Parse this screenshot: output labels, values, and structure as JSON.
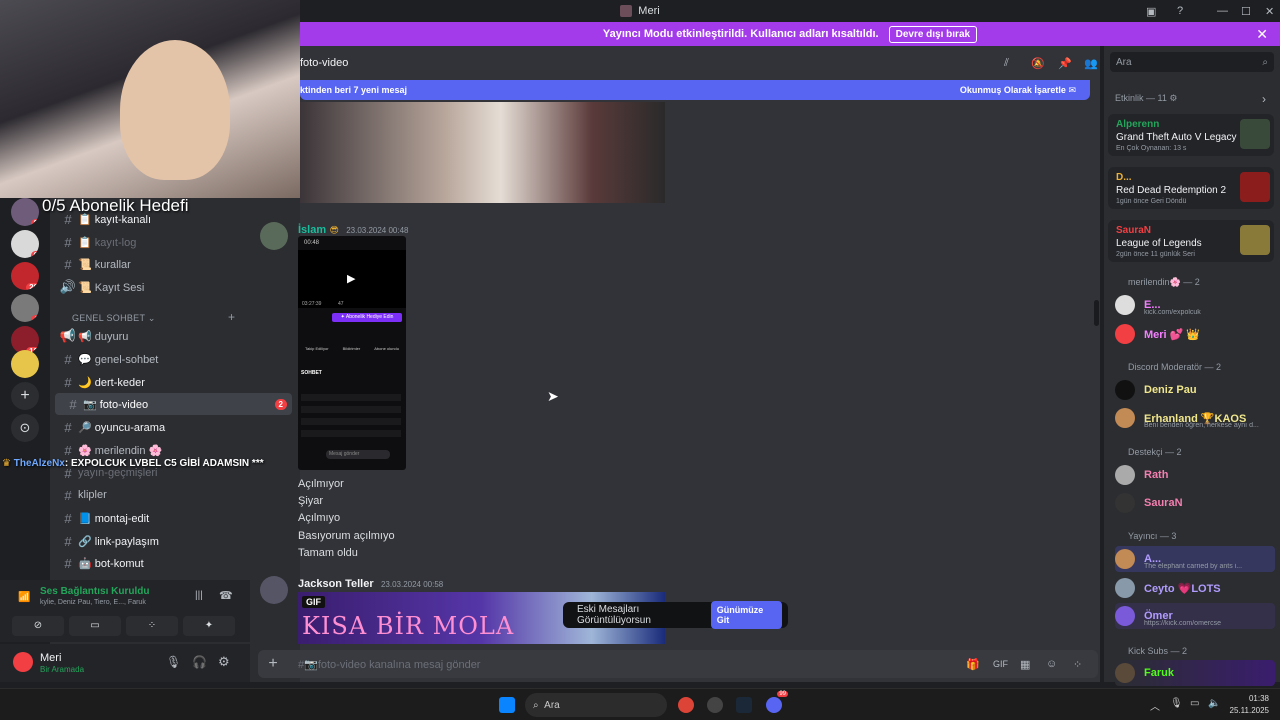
{
  "window": {
    "title": "Meri"
  },
  "banner": {
    "text": "Yayıncı Modu etkinleştirildi. Kullanıcı adları kısaltıldı.",
    "button": "Devre dışı bırak"
  },
  "overlay": {
    "goal": "0/5 Abonelik Hedefi",
    "chat_user": "TheAlzeNx",
    "chat_text": ": EXPOLCUK LVBEL C5 GİBİ ADAMSIN ***"
  },
  "rail": {
    "servers": [
      {
        "badge": "2"
      },
      {
        "badge": "6"
      },
      {
        "badge": "26"
      },
      {
        "badge": "4"
      },
      {
        "badge": "12"
      },
      {
        "badge": ""
      }
    ]
  },
  "channels": {
    "items": [
      {
        "label": "📋 kayıt-kanalı",
        "type": "text"
      },
      {
        "label": "📋 kayıt-log",
        "type": "text"
      },
      {
        "label": "📜 kurallar",
        "type": "text"
      },
      {
        "label": "📜 Kayıt Sesi",
        "type": "voice"
      }
    ],
    "category": "GENEL SOHBET",
    "general": [
      {
        "label": "📢 duyuru"
      },
      {
        "label": "💬 genel-sohbet"
      },
      {
        "label": "🌙 dert-keder"
      },
      {
        "label": "📷 foto-video",
        "count": "2"
      },
      {
        "label": "🔎 oyuncu-arama"
      },
      {
        "label": "🌸 merilendin 🌸"
      },
      {
        "label": "yayın-geçmişleri"
      },
      {
        "label": "klipler"
      },
      {
        "label": "📘 montaj-edit"
      },
      {
        "label": "🔗 link-paylaşım"
      },
      {
        "label": "🤖 bot-komut"
      }
    ]
  },
  "voice": {
    "status": "Ses Bağlantısı Kuruldu",
    "members": "kylie, Deniz Pau, Tiero, E..., Faruk"
  },
  "user": {
    "name": "Meri",
    "status": "Bir Aramada"
  },
  "chat": {
    "channel": "foto-video",
    "new_messages": "ktinden beri 7 yeni mesaj",
    "mark_read": "Okunmuş Olarak İşaretle",
    "msg1": {
      "author": "İslam",
      "time": "23.03.2024 00:48",
      "lines": [
        "Açılmıyor",
        "Şiyar",
        "Açılmıyo",
        "Basıyorum açılmıyo",
        "Tamam oldu"
      ]
    },
    "phone": {
      "time": "00:48",
      "clock": "03:27:39",
      "viewers": "47",
      "gift": "✦ Abonelik Hediye Edin",
      "chat_label": "SOHBET",
      "input": "Mesaj gönder",
      "tabs": [
        "Takip Ediliyor",
        "Bildirimler",
        "Abone olundu"
      ]
    },
    "msg2": {
      "author": "Jackson Teller",
      "time": "23.03.2024 00:58",
      "gif": "GIF",
      "gif_title": "KISA BİR MOLA"
    },
    "old_messages": "Eski Mesajları Görüntülüyorsun",
    "jump": "Günümüze Git",
    "composer_placeholder": "#📷foto-video kanalına mesaj gönder"
  },
  "right": {
    "search_placeholder": "Ara",
    "activity_title": "Etkinlik — 11",
    "activities": [
      {
        "user": "Alperenn",
        "game": "Grand Theft Auto V Legacy",
        "meta": "En Çok Oynanan: 13 s",
        "color": "#23a55a"
      },
      {
        "user": "D...",
        "game": "Red Dead Redemption 2",
        "meta": "1gün önce  Geri Döndü",
        "color": "#f0b232"
      },
      {
        "user": "SauraN",
        "game": "League of Legends",
        "meta": "2gün önce  11 günlük Seri",
        "color": "#f23f43"
      }
    ],
    "groups": [
      {
        "title": "merilendin🌸 — 2",
        "members": [
          {
            "name": "E...",
            "sub": "kick.com/expolcuk",
            "color": "#f47fff"
          },
          {
            "name": "Meri 💕 👑",
            "sub": "",
            "color": "#f47fff"
          }
        ]
      },
      {
        "title": "Discord Moderatör — 2",
        "members": [
          {
            "name": "Deniz Pau",
            "sub": "",
            "color": "#f0e68c"
          },
          {
            "name": "Erhanland 🏆KAOS",
            "sub": "Beni benden öğren, herkese aynı d...",
            "color": "#f0e68c"
          }
        ]
      },
      {
        "title": "Destekçi — 2",
        "members": [
          {
            "name": "Rath",
            "sub": "",
            "color": "#f47fb0"
          },
          {
            "name": "SauraN",
            "sub": "",
            "color": "#f47fb0"
          }
        ]
      },
      {
        "title": "Yayıncı — 3",
        "members": [
          {
            "name": "A...",
            "sub": "The elephant carried by ants i...",
            "color": "#b19cff"
          },
          {
            "name": "Ceyto 💗LOTS",
            "sub": "",
            "color": "#b19cff"
          },
          {
            "name": "Ömer",
            "sub": "https://kick.com/omercse",
            "color": "#b19cff"
          }
        ]
      },
      {
        "title": "Kick Subs — 2",
        "members": [
          {
            "name": "Faruk",
            "sub": "",
            "color": "#53fc18"
          }
        ]
      }
    ]
  },
  "taskbar": {
    "search": "Ara",
    "time": "01:38",
    "date": "25.11.2025",
    "badge": "99"
  }
}
